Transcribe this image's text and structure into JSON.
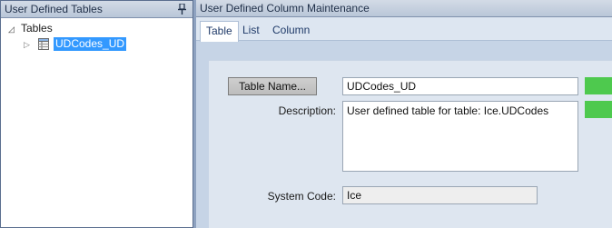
{
  "left_pane": {
    "title": "User Defined Tables",
    "tree": {
      "root_label": "Tables",
      "root_expander": "◿",
      "child_expander": "▷",
      "items": [
        {
          "label": "UDCodes_UD",
          "icon": "table-icon",
          "selected": true
        }
      ]
    }
  },
  "right_pane": {
    "title": "User Defined Column Maintenance",
    "tabs": [
      {
        "label": "Table",
        "active": true
      },
      {
        "label": "List",
        "active": false
      },
      {
        "label": "Column",
        "active": false
      }
    ]
  },
  "form": {
    "table_name_button": "Table Name...",
    "table_name_value": "UDCodes_UD",
    "description_label": "Description:",
    "description_value": "User defined table for table: Ice.UDCodes",
    "system_code_label": "System Code:",
    "system_code_value": "Ice"
  },
  "colors": {
    "selection": "#3399ff",
    "accent_green": "#4ec94e"
  }
}
